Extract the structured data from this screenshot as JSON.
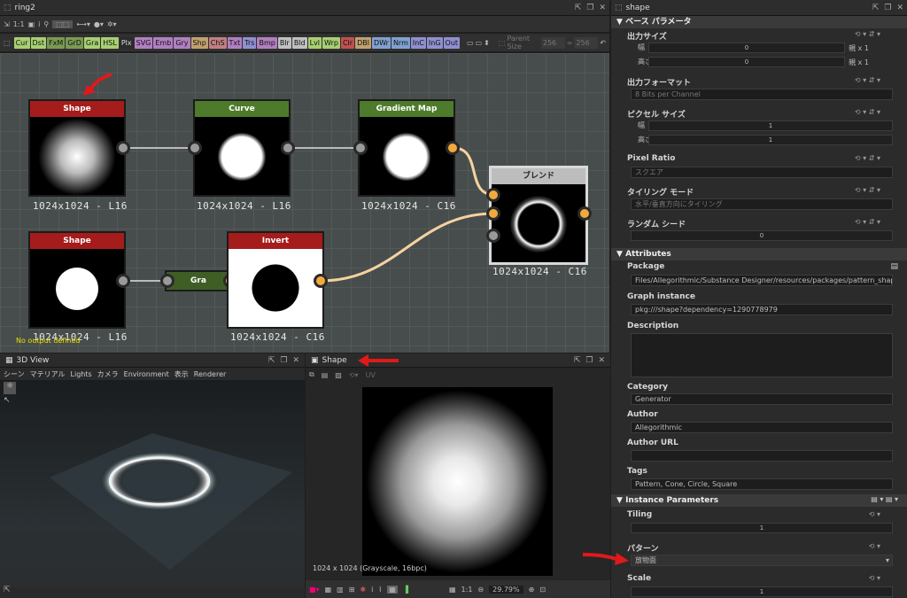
{
  "graph_window": {
    "title": "ring2",
    "toolbar": [
      "1:1",
      "i"
    ],
    "parent_size_label": "Parent Size",
    "parent_size_value": "256",
    "parent_size_value2": "256",
    "chips": [
      {
        "t": "Cur",
        "c": "#a7cf72"
      },
      {
        "t": "Dst",
        "c": "#a7cf72"
      },
      {
        "t": "FxM",
        "c": "#7b9a52"
      },
      {
        "t": "GrD",
        "c": "#7b9a52"
      },
      {
        "t": "Gra",
        "c": "#a7cf72"
      },
      {
        "t": "HSL",
        "c": "#a7cf72"
      },
      {
        "t": "Plx",
        "c": "#2b2b2b"
      },
      {
        "t": "SVG",
        "c": "#b07fc0"
      },
      {
        "t": "Emb",
        "c": "#b07fc0"
      },
      {
        "t": "Gry",
        "c": "#b07fc0"
      },
      {
        "t": "Shp",
        "c": "#c0a070"
      },
      {
        "t": "ChS",
        "c": "#c07f7f"
      },
      {
        "t": "Txt",
        "c": "#b07fc0"
      },
      {
        "t": "Trs",
        "c": "#8f8fd0"
      },
      {
        "t": "Bmp",
        "c": "#b07fc0"
      },
      {
        "t": "Blr",
        "c": "#c0c0c0"
      },
      {
        "t": "Bld",
        "c": "#c0c0c0"
      },
      {
        "t": "Lvl",
        "c": "#a7cf72"
      },
      {
        "t": "Wrp",
        "c": "#a7cf72"
      },
      {
        "t": "Clr",
        "c": "#c05050"
      },
      {
        "t": "DBl",
        "c": "#c0a070"
      },
      {
        "t": "DWr",
        "c": "#80a0d0"
      },
      {
        "t": "Nrm",
        "c": "#80a0d0"
      },
      {
        "t": "InC",
        "c": "#8f8fd0"
      },
      {
        "t": "InG",
        "c": "#8f8fd0"
      },
      {
        "t": "Out",
        "c": "#8f8fd0"
      }
    ],
    "no_output": "No output defined"
  },
  "nodes": {
    "shape1": {
      "title": "Shape",
      "label": "1024x1024 - L16"
    },
    "curve": {
      "title": "Curve",
      "label": "1024x1024 - L16"
    },
    "gradmap": {
      "title": "Gradient Map",
      "label": "1024x1024 - C16"
    },
    "blend": {
      "title": "ブレンド",
      "label": "1024x1024 - C16"
    },
    "shape2": {
      "title": "Shape",
      "label": "1024x1024 - L16"
    },
    "gra": {
      "title": "Gra"
    },
    "invert": {
      "title": "Invert",
      "label": "1024x1024 - C16"
    }
  },
  "view3d": {
    "title": "3D View",
    "menu": [
      "シーン",
      "マテリアル",
      "Lights",
      "カメラ",
      "Environment",
      "表示",
      "Renderer"
    ]
  },
  "view2d": {
    "title": "Shape",
    "uv_label": "UV",
    "info": "1024 x 1024 (Grayscale, 16bpc)",
    "ratio": "1:1",
    "zoom": "29.79%"
  },
  "props": {
    "title": "shape",
    "base_params": "ベース パラメータ",
    "output_size": "出力サイズ",
    "width": "幅",
    "height": "高さ",
    "width_val": "0",
    "height_val": "0",
    "rel": "親 x 1",
    "output_format": "出力フォーマット",
    "format_val": "8 Bits per Channel",
    "pixel_size": "ピクセル サイズ",
    "px_w_val": "1",
    "px_h_val": "1",
    "pixel_ratio": "Pixel Ratio",
    "pixel_ratio_val": "スクエア",
    "tiling_mode": "タイリング モード",
    "tiling_val": "水平/垂直方向にタイリング",
    "random_seed": "ランダム シード",
    "seed_val": "0",
    "attributes": "Attributes",
    "package": "Package",
    "package_val": "Files/Allegorithmic/Substance Designer/resources/packages/pattern_shape.sbs",
    "graph_instance": "Graph instance",
    "graph_instance_val": "pkg:///shape?dependency=1290778979",
    "description": "Description",
    "category": "Category",
    "category_val": "Generator",
    "author": "Author",
    "author_val": "Allegorithmic",
    "author_url": "Author URL",
    "tags": "Tags",
    "tags_val": "Pattern, Cone, Circle, Square",
    "instance_params": "Instance Parameters",
    "tiling": "Tiling",
    "tiling_num": "1",
    "pattern": "パターン",
    "pattern_val": "放物面",
    "scale": "Scale",
    "scale_val": "1"
  }
}
